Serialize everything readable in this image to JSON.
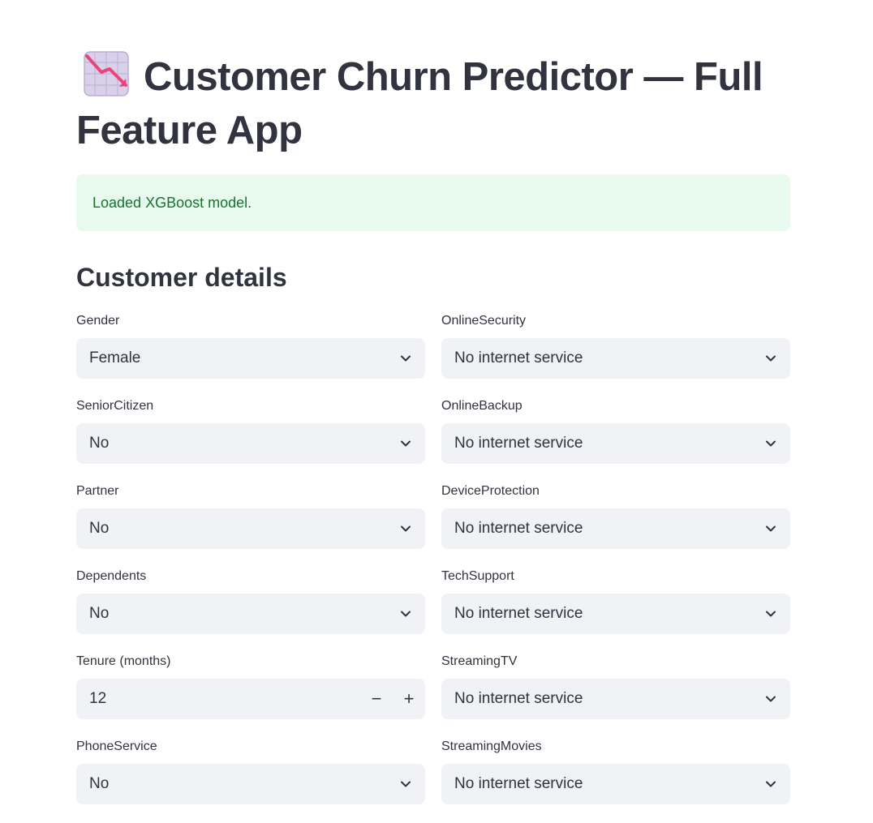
{
  "page": {
    "title": "Customer Churn Predictor — Full Feature App",
    "title_icon": "chart-decreasing-icon"
  },
  "alert": {
    "message": "Loaded XGBoost model.",
    "color": "#177233",
    "background": "#e8f9ee"
  },
  "section": {
    "heading": "Customer details"
  },
  "left_fields": {
    "gender": {
      "label": "Gender",
      "value": "Female"
    },
    "senior_citizen": {
      "label": "SeniorCitizen",
      "value": "No"
    },
    "partner": {
      "label": "Partner",
      "value": "No"
    },
    "dependents": {
      "label": "Dependents",
      "value": "No"
    },
    "tenure": {
      "label": "Tenure (months)",
      "value": "12",
      "decrement": "−",
      "increment": "+"
    },
    "phone_service": {
      "label": "PhoneService",
      "value": "No"
    }
  },
  "right_fields": {
    "online_security": {
      "label": "OnlineSecurity",
      "value": "No internet service"
    },
    "online_backup": {
      "label": "OnlineBackup",
      "value": "No internet service"
    },
    "device_protection": {
      "label": "DeviceProtection",
      "value": "No internet service"
    },
    "tech_support": {
      "label": "TechSupport",
      "value": "No internet service"
    },
    "streaming_tv": {
      "label": "StreamingTV",
      "value": "No internet service"
    },
    "streaming_movies": {
      "label": "StreamingMovies",
      "value": "No internet service"
    }
  }
}
